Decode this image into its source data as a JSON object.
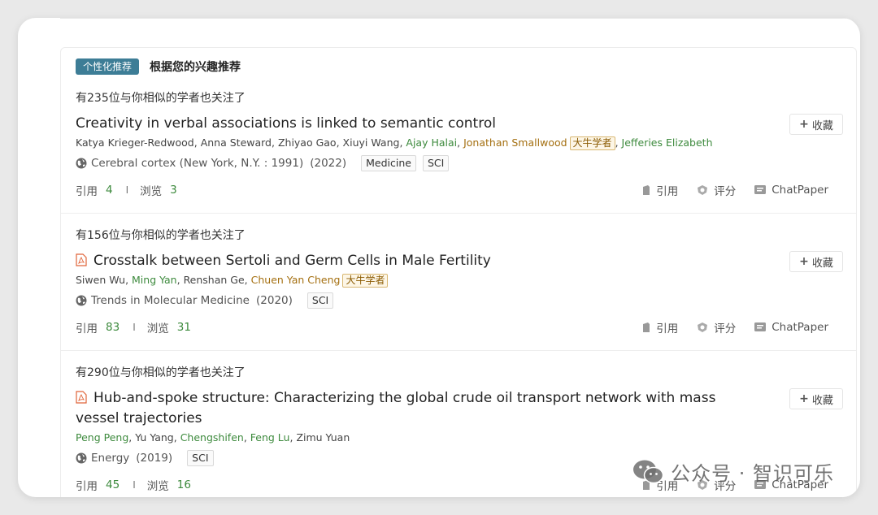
{
  "header": {
    "tag": "个性化推荐",
    "title": "根据您的兴趣推荐"
  },
  "labels": {
    "cite": "引用",
    "view": "浏览",
    "sep": "I",
    "collect": "收藏",
    "action_cite": "引用",
    "action_rate": "评分",
    "action_chat": "ChatPaper"
  },
  "papers": [
    {
      "similar": "有235位与你相似的学者也关注了",
      "title": "Creativity in verbal associations is linked to semantic control",
      "has_pdf": false,
      "authors": [
        {
          "name": "Katya Krieger-Redwood",
          "style": "a"
        },
        {
          "name": "Anna Steward",
          "style": "a"
        },
        {
          "name": "Zhiyao Gao",
          "style": "a"
        },
        {
          "name": "Xiuyi Wang",
          "style": "a"
        },
        {
          "name": "Ajay Halai",
          "style": "g"
        },
        {
          "name": "Jonathan Smallwood",
          "style": "o",
          "badge": "大牛学者"
        },
        {
          "name": "Jefferies Elizabeth",
          "style": "g"
        }
      ],
      "venue": "Cerebral cortex (New York, N.Y. : 1991)",
      "year": "(2022)",
      "chips": [
        "Medicine",
        "SCI"
      ],
      "cite_count": "4",
      "view_count": "3"
    },
    {
      "similar": "有156位与你相似的学者也关注了",
      "title": "Crosstalk between Sertoli and Germ Cells in Male Fertility",
      "has_pdf": true,
      "authors": [
        {
          "name": "Siwen Wu",
          "style": "a"
        },
        {
          "name": "Ming Yan",
          "style": "g"
        },
        {
          "name": "Renshan Ge",
          "style": "a"
        },
        {
          "name": "Chuen Yan Cheng",
          "style": "o",
          "badge": "大牛学者"
        }
      ],
      "venue": "Trends in Molecular Medicine",
      "year": "(2020)",
      "chips": [
        "SCI"
      ],
      "cite_count": "83",
      "view_count": "31"
    },
    {
      "similar": "有290位与你相似的学者也关注了",
      "title_line1": "Hub-and-spoke structure: Characterizing the global crude oil transport network with mass",
      "title_line2": "vessel trajectories",
      "has_pdf": true,
      "authors": [
        {
          "name": "Peng Peng",
          "style": "g"
        },
        {
          "name": "Yu Yang",
          "style": "a"
        },
        {
          "name": "Chengshifen",
          "style": "g"
        },
        {
          "name": "Feng Lu",
          "style": "g"
        },
        {
          "name": "Zimu Yuan",
          "style": "a"
        }
      ],
      "venue": "Energy",
      "year": "(2019)",
      "chips": [
        "SCI"
      ],
      "cite_count": "45",
      "view_count": "16"
    }
  ],
  "watermark": "公众号 · 智识可乐",
  "colors": {
    "tag_bg": "#3d7d96",
    "count_green": "#3d8a3d",
    "author_orange": "#a46f10"
  }
}
